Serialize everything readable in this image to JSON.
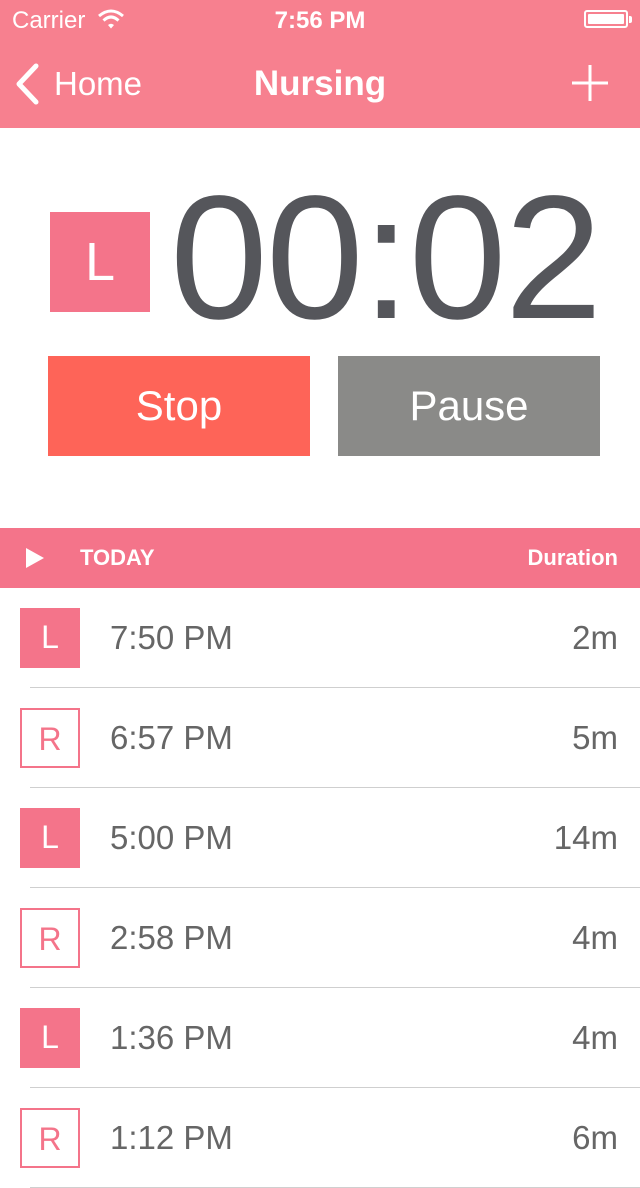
{
  "status_bar": {
    "carrier": "Carrier",
    "time": "7:56 PM"
  },
  "nav": {
    "back_label": "Home",
    "title": "Nursing"
  },
  "timer": {
    "side": "L",
    "elapsed": "00:02",
    "stop_label": "Stop",
    "pause_label": "Pause"
  },
  "section": {
    "title": "TODAY",
    "duration_header": "Duration"
  },
  "sessions": [
    {
      "side": "L",
      "time": "7:50 PM",
      "duration": "2m"
    },
    {
      "side": "R",
      "time": "6:57 PM",
      "duration": "5m"
    },
    {
      "side": "L",
      "time": "5:00 PM",
      "duration": "14m"
    },
    {
      "side": "R",
      "time": "2:58 PM",
      "duration": "4m"
    },
    {
      "side": "L",
      "time": "1:36 PM",
      "duration": "4m"
    },
    {
      "side": "R",
      "time": "1:12 PM",
      "duration": "6m"
    }
  ],
  "icons": {
    "back": "chevron-left-icon",
    "add": "plus-icon",
    "wifi": "wifi-icon",
    "battery": "battery-icon",
    "section_toggle": "play-triangle-icon"
  },
  "colors": {
    "nav": "#f7808f",
    "accent": "#f4748a",
    "stop": "#fe6458",
    "pause": "#8a8a88",
    "timer_text": "#55565b"
  }
}
